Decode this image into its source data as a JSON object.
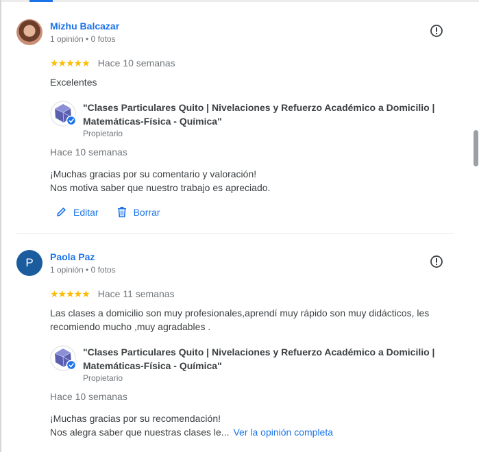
{
  "reviews": [
    {
      "author": "Mizhu Balcazar",
      "meta": "1 opinión • 0 fotos",
      "stars": "★★★★★",
      "rating": 5,
      "date": "Hace 10 semanas",
      "text": "Excelentes",
      "owner_name_line1": "\"Clases Particulares Quito | Nivelaciones y Refuerzo Académico a Domicilio |",
      "owner_name_line2": "Matemáticas-Física - Química\"",
      "owner_role": "Propietario",
      "reply_date": "Hace 10 semanas",
      "reply_line1": "¡Muchas gracias por su comentario y valoración!",
      "reply_line2": "Nos motiva saber que nuestro trabajo es apreciado.",
      "edit_label": "Editar",
      "delete_label": "Borrar"
    },
    {
      "author": "Paola Paz",
      "avatar_letter": "P",
      "meta": "1 opinión • 0 fotos",
      "stars": "★★★★★",
      "rating": 5,
      "date": "Hace 11 semanas",
      "text_line1": "Las clases a domicilio son muy profesionales,aprendí muy rápido son muy didácticos, les",
      "text_line2": "recomiendo mucho ,muy agradables .",
      "owner_name_line1": "\"Clases Particulares Quito | Nivelaciones y Refuerzo Académico a Domicilio |",
      "owner_name_line2": "Matemáticas-Física - Química\"",
      "owner_role": "Propietario",
      "reply_date": "Hace 10 semanas",
      "reply_line1": "¡Muchas gracias por su recomendación!",
      "reply_line2": "Nos alegra saber que nuestras clases le...",
      "see_more": "Ver la opinión completa"
    }
  ],
  "colors": {
    "link": "#1a73e8",
    "star": "#fbbc04",
    "muted": "#70757a",
    "text": "#3c4043"
  },
  "icons": [
    "report-icon",
    "edit-pencil-icon",
    "trash-icon",
    "owner-logo-icon",
    "verified-badge-icon"
  ]
}
